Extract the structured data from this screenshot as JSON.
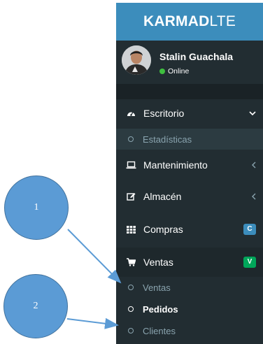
{
  "brand": {
    "bold": "KARMAD",
    "light": "LTE"
  },
  "user": {
    "name": "Stalin Guachala",
    "status": "Online"
  },
  "menu": {
    "escritorio": "Escritorio",
    "estadisticas": "Estadísticas",
    "mantenimiento": "Mantenimiento",
    "almacen": "Almacén",
    "compras": {
      "label": "Compras",
      "badge": "C"
    },
    "ventas": {
      "label": "Ventas",
      "badge": "V"
    },
    "ventas_sub": [
      "Ventas",
      "Pedidos",
      "Clientes"
    ]
  },
  "annotations": [
    "1",
    "2"
  ],
  "colors": {
    "sidebar": "#222d32",
    "brand": "#3c8dbc",
    "badge_compras": "#3c8dbc",
    "badge_ventas": "#00a65a",
    "annotation": "#5b9bd5"
  },
  "icons": {
    "escritorio": "dashboard-icon",
    "mantenimiento": "laptop-icon",
    "almacen": "edit-icon",
    "compras": "grid-icon",
    "ventas": "cart-icon"
  }
}
